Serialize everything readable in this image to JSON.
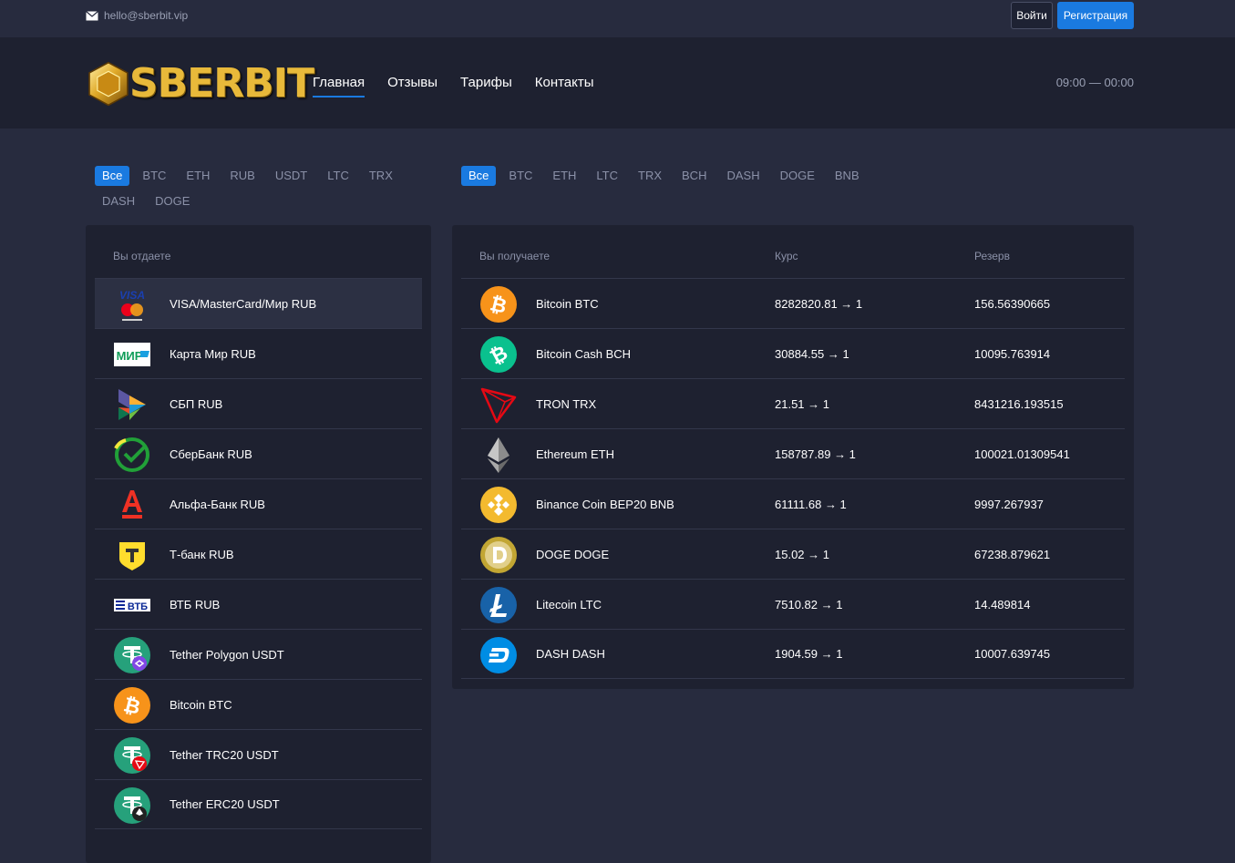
{
  "topbar": {
    "email": "hello@sberbit.vip",
    "login_label": "Войти",
    "register_label": "Регистрация"
  },
  "header": {
    "logo_text": "SBERBIT",
    "nav": [
      "Главная",
      "Отзывы",
      "Тарифы",
      "Контакты"
    ],
    "hours": "09:00 — 00:00"
  },
  "filters_give": [
    "Все",
    "BTC",
    "ETH",
    "RUB",
    "USDT",
    "LTC",
    "TRX",
    "DASH",
    "DOGE"
  ],
  "filters_get": [
    "Все",
    "BTC",
    "ETH",
    "LTC",
    "TRX",
    "BCH",
    "DASH",
    "DOGE",
    "BNB"
  ],
  "give": {
    "header": "Вы отдаете",
    "items": [
      {
        "name": "VISA/MasterCard/Мир RUB",
        "icon": "visa-mastercard-icon"
      },
      {
        "name": "Карта Мир RUB",
        "icon": "mir-icon"
      },
      {
        "name": "СБП RUB",
        "icon": "sbp-icon"
      },
      {
        "name": "СберБанк RUB",
        "icon": "sberbank-icon"
      },
      {
        "name": "Альфа-Банк RUB",
        "icon": "alfa-bank-icon"
      },
      {
        "name": "Т-банк RUB",
        "icon": "t-bank-icon"
      },
      {
        "name": "ВТБ RUB",
        "icon": "vtb-icon"
      },
      {
        "name": "Tether Polygon USDT",
        "icon": "tether-polygon-icon"
      },
      {
        "name": "Bitcoin BTC",
        "icon": "bitcoin-icon"
      },
      {
        "name": "Tether TRC20 USDT",
        "icon": "tether-trc20-icon"
      },
      {
        "name": "Tether ERC20 USDT",
        "icon": "tether-erc20-icon"
      }
    ]
  },
  "get": {
    "header_name": "Вы получаете",
    "header_rate": "Курс",
    "header_reserve": "Резерв",
    "items": [
      {
        "name": "Bitcoin BTC",
        "rate": "8282820.81 → 1",
        "reserve": "156.56390665",
        "icon": "bitcoin-icon",
        "color": "#f7931a"
      },
      {
        "name": "Bitcoin Cash BCH",
        "rate": "30884.55 → 1",
        "reserve": "10095.763914",
        "icon": "bitcoin-cash-icon",
        "color": "#0ac18e"
      },
      {
        "name": "TRON TRX",
        "rate": "21.51 → 1",
        "reserve": "8431216.193515",
        "icon": "tron-icon",
        "color": "#e50914"
      },
      {
        "name": "Ethereum ETH",
        "rate": "158787.89 → 1",
        "reserve": "100021.01309541",
        "icon": "ethereum-icon",
        "color": "#62688f"
      },
      {
        "name": "Binance Coin BEP20 BNB",
        "rate": "61111.68 → 1",
        "reserve": "9997.267937",
        "icon": "bnb-icon",
        "color": "#f3ba2f"
      },
      {
        "name": "DOGE DOGE",
        "rate": "15.02 → 1",
        "reserve": "67238.879621",
        "icon": "doge-icon",
        "color": "#c2a633"
      },
      {
        "name": "Litecoin LTC",
        "rate": "7510.82 → 1",
        "reserve": "14.489814",
        "icon": "litecoin-icon",
        "color": "#1862a8"
      },
      {
        "name": "DASH DASH",
        "rate": "1904.59 → 1",
        "reserve": "10007.639745",
        "icon": "dash-icon",
        "color": "#008de4"
      }
    ]
  },
  "colors": {
    "accent": "#1a7ae0",
    "page_bg": "#272b3e",
    "panel_bg": "#1e2130"
  }
}
